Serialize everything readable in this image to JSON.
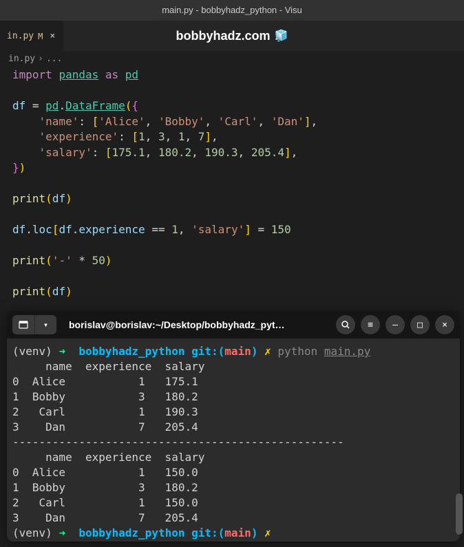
{
  "window": {
    "title": "main.py - bobbyhadz_python - Visu"
  },
  "tab": {
    "label": "in.py",
    "modified": "M",
    "close": "×"
  },
  "watermark": {
    "text": "bobbyhadz.com",
    "emoji": "🧊"
  },
  "breadcrumb": {
    "file": "in.py",
    "rest": "..."
  },
  "code": {
    "l1_import": "import",
    "l1_pandas": "pandas",
    "l1_as": "as",
    "l1_pd": "pd",
    "l3_df": "df",
    "l3_eq": " = ",
    "l3_pd": "pd",
    "l3_dot": ".",
    "l3_DataFrame": "DataFrame",
    "l3_open": "({",
    "l4_key": "'name'",
    "l4_colon": ": ",
    "l4_vals": "['Alice', 'Bobby', 'Carl', 'Dan']",
    "l4_v1": "'Alice'",
    "l4_v2": "'Bobby'",
    "l4_v3": "'Carl'",
    "l4_v4": "'Dan'",
    "l5_key": "'experience'",
    "l5_v1": "1",
    "l5_v2": "3",
    "l5_v3": "1",
    "l5_v4": "7",
    "l6_key": "'salary'",
    "l6_v1": "175.1",
    "l6_v2": "180.2",
    "l6_v3": "190.3",
    "l6_v4": "205.4",
    "l7_close": "})",
    "l9_print": "print",
    "l9_arg": "df",
    "l11_df": "df",
    "l11_loc": "loc",
    "l11_exp": "experience",
    "l11_eqeq": "==",
    "l11_one": "1",
    "l11_sal": "'salary'",
    "l11_assign": " = ",
    "l11_val": "150",
    "l13_print": "print",
    "l13_dash": "'-'",
    "l13_star": " * ",
    "l13_fifty": "50",
    "l15_print": "print",
    "l15_arg": "df"
  },
  "terminal": {
    "title": "borislav@borislav:~/Desktop/bobbyhadz_pyt…",
    "prompt": {
      "venv": "(venv)",
      "arrow": "➜",
      "path": "bobbyhadz_python",
      "git": "git:",
      "branch": "main",
      "x": "✗",
      "cmd": "python",
      "file": "main.py"
    },
    "output": {
      "header": "     name  experience  salary",
      "r0": "0  Alice           1   175.1",
      "r1": "1  Bobby           3   180.2",
      "r2": "2   Carl           1   190.3",
      "r3": "3    Dan           7   205.4",
      "sep": "--------------------------------------------------",
      "header2": "     name  experience  salary",
      "s0": "0  Alice           1   150.0",
      "s1": "1  Bobby           3   180.2",
      "s2": "2   Carl           1   150.0",
      "s3": "3    Dan           7   205.4"
    }
  }
}
